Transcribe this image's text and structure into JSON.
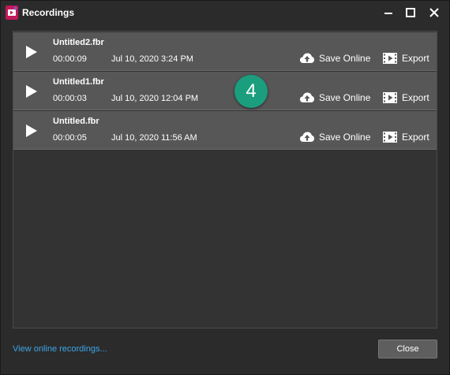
{
  "window": {
    "title": "Recordings"
  },
  "recordings": [
    {
      "name": "Untitled2.fbr",
      "duration": "00:00:09",
      "date": "Jul 10, 2020 3:24 PM",
      "save_label": "Save Online",
      "export_label": "Export"
    },
    {
      "name": "Untitled1.fbr",
      "duration": "00:00:03",
      "date": "Jul 10, 2020 12:04 PM",
      "save_label": "Save Online",
      "export_label": "Export"
    },
    {
      "name": "Untitled.fbr",
      "duration": "00:00:05",
      "date": "Jul 10, 2020 11:56 AM",
      "save_label": "Save Online",
      "export_label": "Export"
    }
  ],
  "badge": {
    "number": "4",
    "color": "#1a9e7e"
  },
  "footer": {
    "link_label": "View online recordings...",
    "close_label": "Close"
  },
  "colors": {
    "link": "#3ea6e8",
    "row_bg": "#575757",
    "window_bg": "#2b2b2b"
  }
}
